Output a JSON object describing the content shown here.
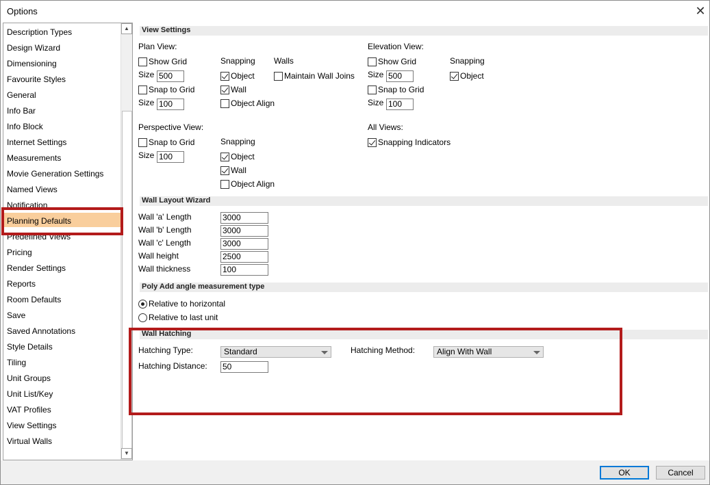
{
  "window": {
    "title": "Options",
    "close_glyph": "✕"
  },
  "nav": {
    "items": [
      "Description Types",
      "Design Wizard",
      "Dimensioning",
      "Favourite Styles",
      "General",
      "Info Bar",
      "Info Block",
      "Internet Settings",
      "Measurements",
      "Movie Generation Settings",
      "Named Views",
      "Notification",
      "Planning Defaults",
      "Predefined Views",
      "Pricing",
      "Render Settings",
      "Reports",
      "Room Defaults",
      "Save",
      "Saved Annotations",
      "Style Details",
      "Tiling",
      "Unit Groups",
      "Unit List/Key",
      "VAT Profiles",
      "View Settings",
      "Virtual Walls"
    ],
    "selected": "Planning Defaults",
    "scroll_up_glyph": "▲",
    "scroll_down_glyph": "▼"
  },
  "view_settings": {
    "title": "View Settings",
    "plan_view": {
      "label": "Plan View:",
      "show_grid": {
        "label": "Show Grid",
        "checked": false
      },
      "size1_label": "Size",
      "size1_value": "500",
      "snap_to_grid": {
        "label": "Snap to Grid",
        "checked": false
      },
      "size2_label": "Size",
      "size2_value": "100",
      "snapping_label": "Snapping",
      "object": {
        "label": "Object",
        "checked": true
      },
      "wall": {
        "label": "Wall",
        "checked": true
      },
      "object_align": {
        "label": "Object Align",
        "checked": false
      },
      "walls_label": "Walls",
      "maintain_wall_joins": {
        "label": "Maintain Wall Joins",
        "checked": false
      }
    },
    "elevation_view": {
      "label": "Elevation View:",
      "show_grid": {
        "label": "Show Grid",
        "checked": false
      },
      "size1_label": "Size",
      "size1_value": "500",
      "snap_to_grid": {
        "label": "Snap to Grid",
        "checked": false
      },
      "size2_label": "Size",
      "size2_value": "100",
      "snapping_label": "Snapping",
      "object": {
        "label": "Object",
        "checked": true
      }
    },
    "perspective_view": {
      "label": "Perspective View:",
      "snap_to_grid": {
        "label": "Snap to Grid",
        "checked": false
      },
      "size_label": "Size",
      "size_value": "100",
      "snapping_label": "Snapping",
      "object": {
        "label": "Object",
        "checked": true
      },
      "wall": {
        "label": "Wall",
        "checked": true
      },
      "object_align": {
        "label": "Object Align",
        "checked": false
      }
    },
    "all_views": {
      "label": "All Views:",
      "snapping_indicators": {
        "label": "Snapping Indicators",
        "checked": true
      }
    }
  },
  "wall_layout_wizard": {
    "title": "Wall Layout Wizard",
    "fields": [
      {
        "label": "Wall 'a' Length",
        "value": "3000"
      },
      {
        "label": "Wall 'b' Length",
        "value": "3000"
      },
      {
        "label": "Wall 'c' Length",
        "value": "3000"
      },
      {
        "label": "Wall height",
        "value": "2500"
      },
      {
        "label": "Wall thickness",
        "value": "100"
      }
    ]
  },
  "poly_add": {
    "title": "Poly Add angle measurement type",
    "options": [
      {
        "label": "Relative to horizontal",
        "checked": true
      },
      {
        "label": "Relative to last unit",
        "checked": false
      }
    ]
  },
  "wall_hatching": {
    "title": "Wall Hatching",
    "hatching_type_label": "Hatching Type:",
    "hatching_type_value": "Standard",
    "hatching_method_label": "Hatching Method:",
    "hatching_method_value": "Align With Wall",
    "hatching_distance_label": "Hatching Distance:",
    "hatching_distance_value": "50"
  },
  "footer": {
    "ok_label": "OK",
    "cancel_label": "Cancel"
  },
  "colors": {
    "highlight": "#f9ce9c",
    "annotation_red": "#b31b1b",
    "section_bar": "#ececec"
  }
}
